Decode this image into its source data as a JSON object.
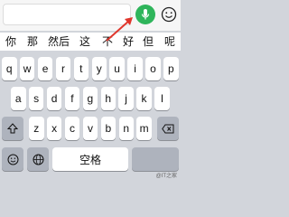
{
  "input": {
    "value": ""
  },
  "toolbar": {
    "mic_icon": "microphone-icon",
    "emoji_icon": "emoji-icon",
    "mic_color": "#2fb55b",
    "arrow_color": "#e0362c"
  },
  "candidates": [
    "你",
    "那",
    "然后",
    "这",
    "不",
    "好",
    "但",
    "呢"
  ],
  "keyboard": {
    "row1": [
      "q",
      "w",
      "e",
      "r",
      "t",
      "y",
      "u",
      "i",
      "o",
      "p"
    ],
    "row2": [
      "a",
      "s",
      "d",
      "f",
      "g",
      "h",
      "j",
      "k",
      "l"
    ],
    "row3": [
      "z",
      "x",
      "c",
      "v",
      "b",
      "n",
      "m"
    ],
    "shift_icon": "shift-icon",
    "delete_icon": "backspace-icon",
    "space_label": "空格",
    "left_func_icon": "emoji-key-icon",
    "num_key_icon": "globe-icon"
  },
  "watermark": "@IT之家"
}
